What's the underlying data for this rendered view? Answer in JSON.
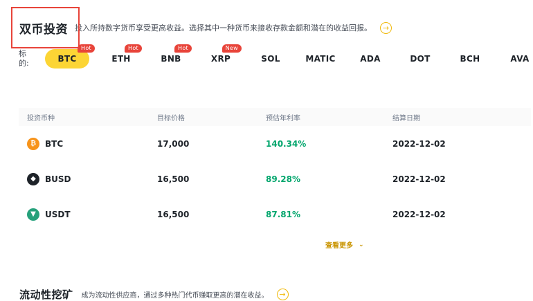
{
  "dual_invest": {
    "title": "双币投资",
    "description": "投入所持数字货币享受更高收益。选择其中一种货币来接收存款金额和潜在的收益回报。",
    "arrow_icon": "arrow-right-circle-icon"
  },
  "coin_bar": {
    "label": "标的:",
    "tabs": [
      {
        "label": "BTC",
        "badge": "Hot",
        "active": true
      },
      {
        "label": "ETH",
        "badge": "Hot"
      },
      {
        "label": "BNB",
        "badge": "Hot"
      },
      {
        "label": "XRP",
        "badge": "New"
      },
      {
        "label": "SOL"
      },
      {
        "label": "MATIC"
      },
      {
        "label": "ADA"
      },
      {
        "label": "DOT"
      },
      {
        "label": "BCH"
      },
      {
        "label": "AVA"
      }
    ]
  },
  "table": {
    "headers": [
      "投资币种",
      "目标价格",
      "预估年利率",
      "结算日期"
    ],
    "rows": [
      {
        "coin": "BTC",
        "icon": "btc-coin-icon",
        "icon_color": "#f7931a",
        "target_price": "17,000",
        "apy": "140.34%",
        "settle_date": "2022-12-02"
      },
      {
        "coin": "BUSD",
        "icon": "busd-coin-icon",
        "icon_color": "#1e2329",
        "target_price": "16,500",
        "apy": "89.28%",
        "settle_date": "2022-12-02"
      },
      {
        "coin": "USDT",
        "icon": "usdt-coin-icon",
        "icon_color": "#26a17b",
        "target_price": "16,500",
        "apy": "87.81%",
        "settle_date": "2022-12-02"
      }
    ]
  },
  "see_more": {
    "label": "查看更多"
  },
  "liquidity": {
    "title": "流动性挖矿",
    "description": "成为流动性供应商，通过多种热门代币赚取更高的潜在收益。"
  },
  "colors": {
    "accent": "#fcd535",
    "positive": "#03a66d",
    "badge": "#e8443a"
  }
}
